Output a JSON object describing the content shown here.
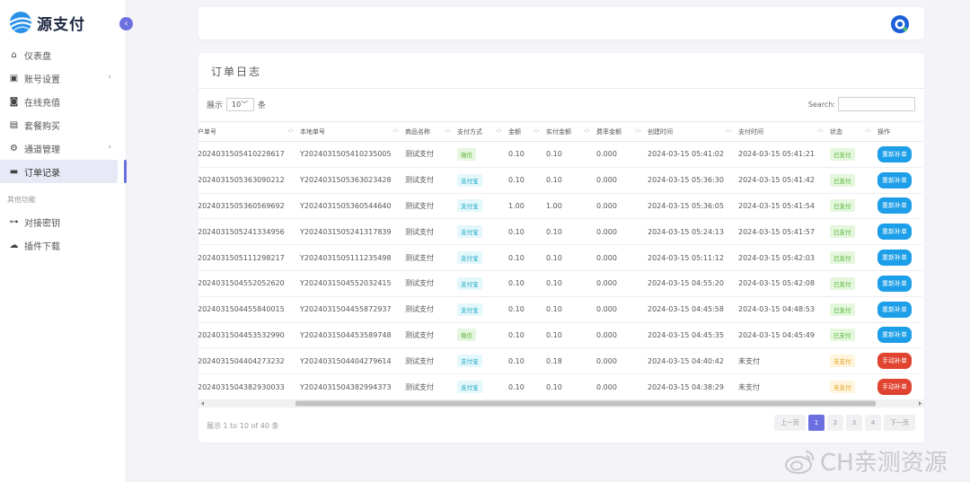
{
  "app": {
    "logo_text": "源支付"
  },
  "sidebar": {
    "items": [
      {
        "label": "仪表盘",
        "icon": "home-icon",
        "chevron": false,
        "active": false
      },
      {
        "label": "账号设置",
        "icon": "id-card-icon",
        "chevron": true,
        "active": false
      },
      {
        "label": "在线充值",
        "icon": "wallet-icon",
        "chevron": false,
        "active": false
      },
      {
        "label": "套餐购买",
        "icon": "package-icon",
        "chevron": false,
        "active": false
      },
      {
        "label": "通道管理",
        "icon": "gear-icon",
        "chevron": true,
        "active": false
      },
      {
        "label": "订单记录",
        "icon": "receipt-icon",
        "chevron": false,
        "active": true
      }
    ],
    "section_title": "其他功能",
    "other_items": [
      {
        "label": "对接密钥",
        "icon": "key-icon"
      },
      {
        "label": "插件下载",
        "icon": "cloud-download-icon"
      }
    ]
  },
  "card": {
    "title": "订单日志",
    "length_prefix": "展示",
    "length_value": "10",
    "length_suffix": "条",
    "search_label": "Search:",
    "search_value": "",
    "columns": [
      "户单号",
      "本地单号",
      "商品名称",
      "支付方式",
      "金额",
      "实付金额",
      "费率金额",
      "创建时间",
      "支付时间",
      "状态",
      "操作"
    ],
    "rows": [
      [
        "2024031505410228617",
        "Y2024031505410235005",
        "测试支付",
        "微信",
        "0.10",
        "0.10",
        "0.000",
        "2024-03-15 05:41:02",
        "2024-03-15 05:41:21",
        "已支付",
        "重新补单"
      ],
      [
        "2024031505363090212",
        "Y2024031505363023428",
        "测试支付",
        "支付宝",
        "0.10",
        "0.10",
        "0.000",
        "2024-03-15 05:36:30",
        "2024-03-15 05:41:42",
        "已支付",
        "重新补单"
      ],
      [
        "2024031505360569692",
        "Y2024031505360544640",
        "测试支付",
        "支付宝",
        "1.00",
        "1.00",
        "0.000",
        "2024-03-15 05:36:05",
        "2024-03-15 05:41:54",
        "已支付",
        "重新补单"
      ],
      [
        "2024031505241334956",
        "Y2024031505241317839",
        "测试支付",
        "支付宝",
        "0.10",
        "0.10",
        "0.000",
        "2024-03-15 05:24:13",
        "2024-03-15 05:41:57",
        "已支付",
        "重新补单"
      ],
      [
        "2024031505111298217",
        "Y2024031505111235498",
        "测试支付",
        "支付宝",
        "0.10",
        "0.10",
        "0.000",
        "2024-03-15 05:11:12",
        "2024-03-15 05:42:03",
        "已支付",
        "重新补单"
      ],
      [
        "2024031504552052620",
        "Y2024031504552032415",
        "测试支付",
        "支付宝",
        "0.10",
        "0.10",
        "0.000",
        "2024-03-15 04:55:20",
        "2024-03-15 05:42:08",
        "已支付",
        "重新补单"
      ],
      [
        "2024031504455840015",
        "Y2024031504455872937",
        "测试支付",
        "支付宝",
        "0.10",
        "0.10",
        "0.000",
        "2024-03-15 04:45:58",
        "2024-03-15 04:48:53",
        "已支付",
        "重新补单"
      ],
      [
        "2024031504453532990",
        "Y2024031504453589748",
        "测试支付",
        "微信",
        "0.10",
        "0.10",
        "0.000",
        "2024-03-15 04:45:35",
        "2024-03-15 04:45:49",
        "已支付",
        "重新补单"
      ],
      [
        "2024031504404273232",
        "Y2024031504404279614",
        "测试支付",
        "支付宝",
        "0.10",
        "0.18",
        "0.000",
        "2024-03-15 04:40:42",
        "未支付",
        "未支付",
        "手动补单"
      ],
      [
        "2024031504382930033",
        "Y2024031504382994373",
        "测试支付",
        "支付宝",
        "0.10",
        "0.10",
        "0.000",
        "2024-03-15 04:38:29",
        "未支付",
        "未支付",
        "手动补单"
      ]
    ],
    "info": "展示 1 to 10 of 40 条",
    "pager": {
      "prev": "上一页",
      "pages": [
        "1",
        "2",
        "3",
        "4"
      ],
      "active_page": "1",
      "next": "下一页"
    }
  },
  "watermark": {
    "text": "CH亲测资源"
  },
  "colors": {
    "accent": "#6c6fe0",
    "blue_button": "#1c9ee8",
    "red_button": "#e0432f"
  }
}
